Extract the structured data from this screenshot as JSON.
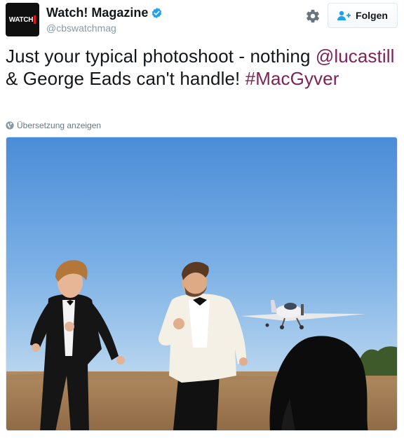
{
  "header": {
    "avatar_text": "WATCH",
    "display_name": "Watch! Magazine",
    "handle": "@cbswatchmag",
    "follow_label": "Folgen"
  },
  "tweet": {
    "text_part1": "Just your typical photoshoot - nothing ",
    "mention": "@lucastill",
    "text_part2": " & George Eads can't handle! ",
    "hashtag": "#MacGyver",
    "translate_label": "Übersetzung anzeigen"
  },
  "colors": {
    "link": "#7d2359",
    "verified": "#1da1f2",
    "muted": "#8899a6"
  },
  "icons": {
    "settings": "gear-icon",
    "follow": "follow-person-plus-icon",
    "verified": "verified-badge-icon",
    "translate": "globe-icon"
  }
}
